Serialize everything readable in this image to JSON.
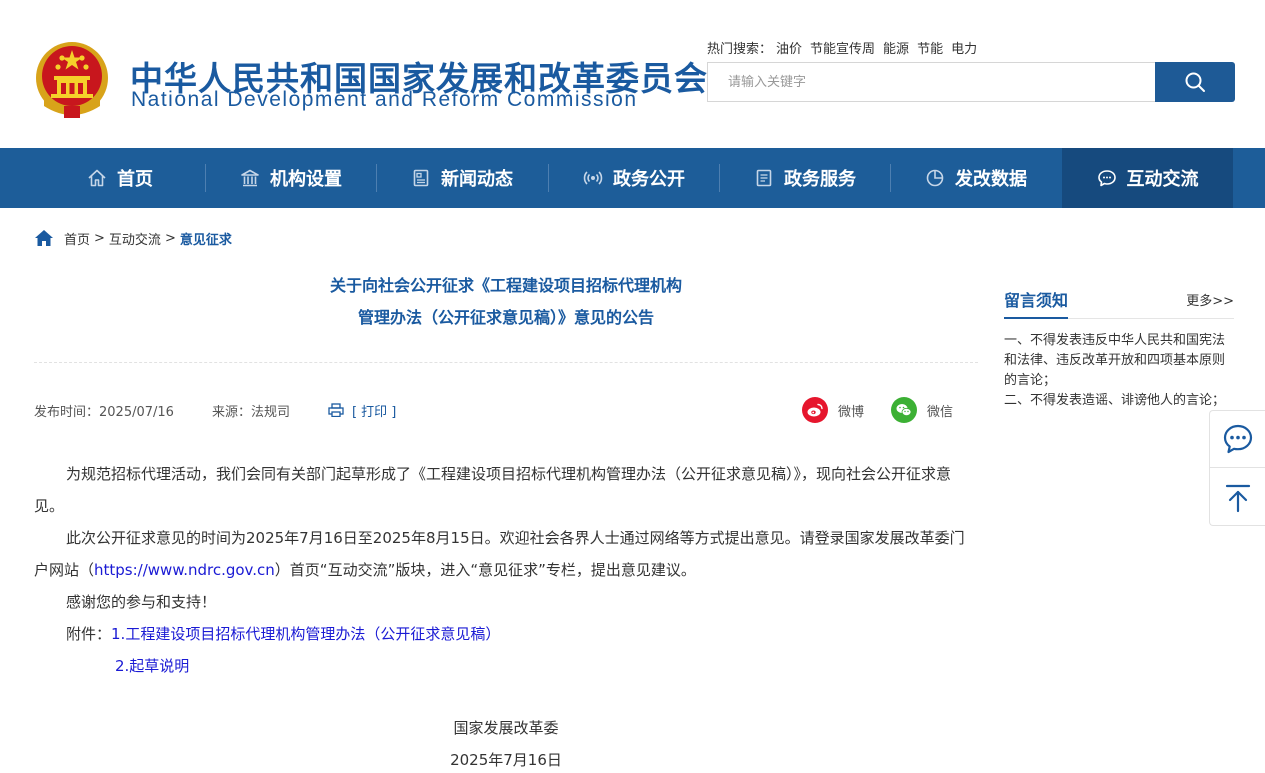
{
  "header": {
    "site_name_cn": "中华人民共和国国家发展和改革委员会",
    "site_name_en": "National Development and Reform Commission",
    "hot_label": "热门搜索：",
    "hot_items": [
      "油价",
      "节能宣传周",
      "能源",
      "节能",
      "电力"
    ],
    "search_placeholder": "请输入关键字"
  },
  "nav": {
    "items": [
      {
        "label": "首页",
        "icon": "home-icon"
      },
      {
        "label": "机构设置",
        "icon": "building-icon"
      },
      {
        "label": "新闻动态",
        "icon": "news-icon"
      },
      {
        "label": "政务公开",
        "icon": "broadcast-icon"
      },
      {
        "label": "政务服务",
        "icon": "service-icon"
      },
      {
        "label": "发改数据",
        "icon": "pie-chart-icon"
      },
      {
        "label": "互动交流",
        "icon": "chat-icon"
      }
    ],
    "active": "互动交流"
  },
  "breadcrumb": {
    "home": "首页",
    "sep": ">",
    "level1": "互动交流",
    "current": "意见征求"
  },
  "article": {
    "title_line1": "关于向社会公开征求《工程建设项目招标代理机构",
    "title_line2": "管理办法（公开征求意见稿）》意见的公告",
    "publish_time": "发布时间：2025/07/16",
    "source": "来源：法规司",
    "print": "[ 打印 ]",
    "share_weibo": "微博",
    "share_wechat": "微信",
    "para1": "为规范招标代理活动，我们会同有关部门起草形成了《工程建设项目招标代理机构管理办法（公开征求意见稿）》，现向社会公开征求意见。",
    "para2_a": "此次公开征求意见的时间为2025年7月16日至2025年8月15日。欢迎社会各界人士通过网络等方式提出意见。请登录国家发展改革委门户网站（",
    "para2_link": "https://www.ndrc.gov.cn",
    "para2_b": "）首页“互动交流”版块，进入“意见征求”专栏，提出意见建议。",
    "para3": "感谢您的参与和支持！",
    "attach_label": "附件：",
    "attach1": "1.工程建设项目招标代理机构管理办法（公开征求意见稿）",
    "attach2": "2.起草说明",
    "sign_org": "国家发展改革委",
    "sign_date": "2025年7月16日"
  },
  "sidebar": {
    "title": "留言须知",
    "more": "更多>>",
    "rule1": "一、不得发表违反中华人民共和国宪法和法律、违反改革开放和四项基本原则的言论；",
    "rule2": "二、不得发表造谣、诽谤他人的言论；"
  },
  "colors": {
    "brand_blue": "#1d5d99",
    "nav_active": "#164a7e",
    "link_blue": "#1a1ad4",
    "weibo_red": "#e6162d",
    "wechat_green": "#3cb034"
  }
}
